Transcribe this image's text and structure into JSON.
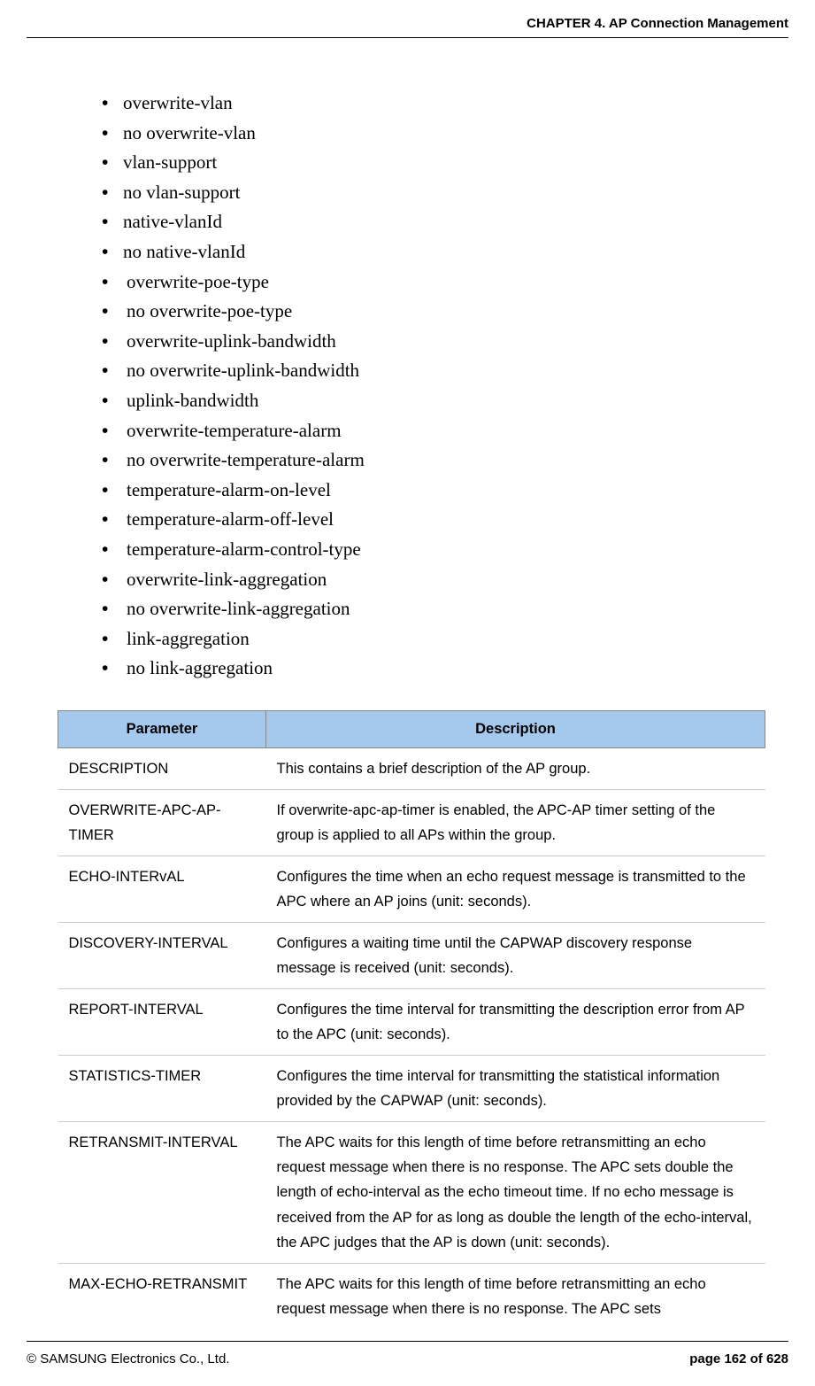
{
  "header": {
    "chapter": "CHAPTER 4. AP Connection Management"
  },
  "bullets": [
    "overwrite-vlan",
    "no overwrite-vlan",
    "vlan-support",
    "no vlan-support",
    "native-vlanId",
    "no native-vlanId",
    "overwrite-poe-type",
    "no  overwrite-poe-type",
    "overwrite-uplink-bandwidth",
    "no  overwrite-uplink-bandwidth",
    "uplink-bandwidth",
    "overwrite-temperature-alarm",
    "no  overwrite-temperature-alarm",
    "temperature-alarm-on-level",
    "temperature-alarm-off-level",
    "temperature-alarm-control-type",
    "overwrite-link-aggregation",
    "no  overwrite-link-aggregation",
    "link-aggregation",
    "no  link-aggregation"
  ],
  "table": {
    "headers": [
      "Parameter",
      "Description"
    ],
    "rows": [
      {
        "param": "DESCRIPTION",
        "desc": "This contains a brief description of the AP group."
      },
      {
        "param": "OVERWRITE-APC-AP-TIMER",
        "desc": "If overwrite-apc-ap-timer is enabled, the APC-AP timer setting of the group is applied to all APs within the group."
      },
      {
        "param": "ECHO-INTERvAL",
        "desc": "Configures the time when an echo request message is transmitted to the APC where an AP joins (unit: seconds)."
      },
      {
        "param": "DISCOVERY-INTERVAL",
        "desc": "Configures a waiting time until the CAPWAP discovery response message is received (unit: seconds)."
      },
      {
        "param": "REPORT-INTERVAL",
        "desc": "Configures the time interval for transmitting the description error from AP to the APC (unit: seconds)."
      },
      {
        "param": "STATISTICS-TIMER",
        "desc": "Configures the time interval for transmitting the statistical information provided by the CAPWAP (unit: seconds)."
      },
      {
        "param": "RETRANSMIT-INTERVAL",
        "desc": "The APC waits for this length of time before retransmitting an echo request message when there is no response. The APC sets double the length of echo-interval as the echo timeout time. If no echo message is received from the AP for as long as double the length of the echo-interval, the APC judges that the AP is down (unit: seconds)."
      },
      {
        "param": "MAX-ECHO-RETRANSMIT",
        "desc": "The APC waits for this length of time before retransmitting an echo request message when there is no response. The APC sets"
      }
    ]
  },
  "footer": {
    "copyright": "© SAMSUNG Electronics Co., Ltd.",
    "page": "page 162 of 628"
  }
}
